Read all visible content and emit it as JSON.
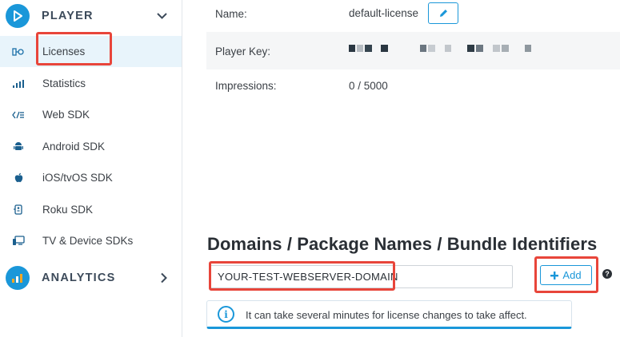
{
  "sidebar": {
    "player_section": {
      "label": "PLAYER",
      "icon": "play-circle-icon",
      "expanded": true
    },
    "items": [
      {
        "label": "Licenses",
        "icon": "license-key-icon",
        "active": true
      },
      {
        "label": "Statistics",
        "icon": "bar-chart-icon",
        "active": false
      },
      {
        "label": "Web SDK",
        "icon": "web-code-icon",
        "active": false
      },
      {
        "label": "Android SDK",
        "icon": "android-icon",
        "active": false
      },
      {
        "label": "iOS/tvOS SDK",
        "icon": "apple-icon",
        "active": false
      },
      {
        "label": "Roku SDK",
        "icon": "roku-icon",
        "active": false
      },
      {
        "label": "TV & Device SDKs",
        "icon": "tv-device-icon",
        "active": false
      }
    ],
    "analytics_section": {
      "label": "ANALYTICS",
      "icon": "analytics-chart-icon",
      "expanded": false
    }
  },
  "license": {
    "name_label": "Name:",
    "name_value": "default-license",
    "key_label": "Player Key:",
    "key_value_obscured": true,
    "impressions_label": "Impressions:",
    "impressions_value": "0 / 5000"
  },
  "domains": {
    "title": "Domains / Package Names / Bundle Identifiers",
    "input_value": "YOUR-TEST-WEBSERVER-DOMAIN",
    "add_label": "Add",
    "help_glyph": "?",
    "info_text": "It can take several minutes for license changes to take affect."
  },
  "colors": {
    "accent": "#1a97d9",
    "highlight": "#e8453a",
    "active_bg": "#e8f4fb"
  }
}
